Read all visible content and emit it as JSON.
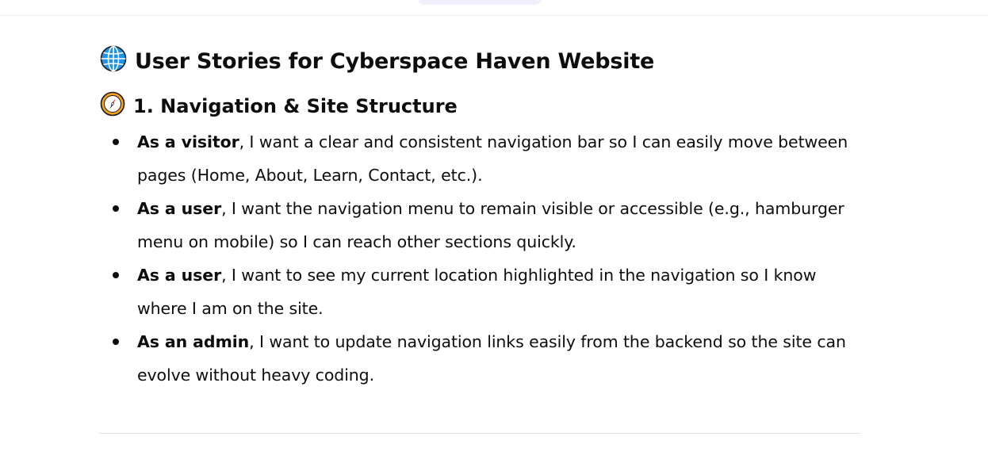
{
  "heading": {
    "icon": "globe-icon",
    "title": "User Stories for Cyberspace Haven Website"
  },
  "section": {
    "icon": "compass-icon",
    "title": "1. Navigation & Site Structure",
    "stories": [
      {
        "role": "As a visitor",
        "text": ", I want a clear and consistent navigation bar so I can easily move between pages (Home, About, Learn, Contact, etc.)."
      },
      {
        "role": "As a user",
        "text": ", I want the navigation menu to remain visible or accessible (e.g., hamburger menu on mobile) so I can reach other sections quickly."
      },
      {
        "role": "As a user",
        "text": ", I want to see my current location highlighted in the navigation so I know where I am on the site."
      },
      {
        "role": "As an admin",
        "text": ", I want to update navigation links easily from the backend so the site can evolve without heavy coding."
      }
    ]
  },
  "colors": {
    "text": "#0d0d0d",
    "divider": "#e3e3e3",
    "top_pill": "#f1effb"
  }
}
